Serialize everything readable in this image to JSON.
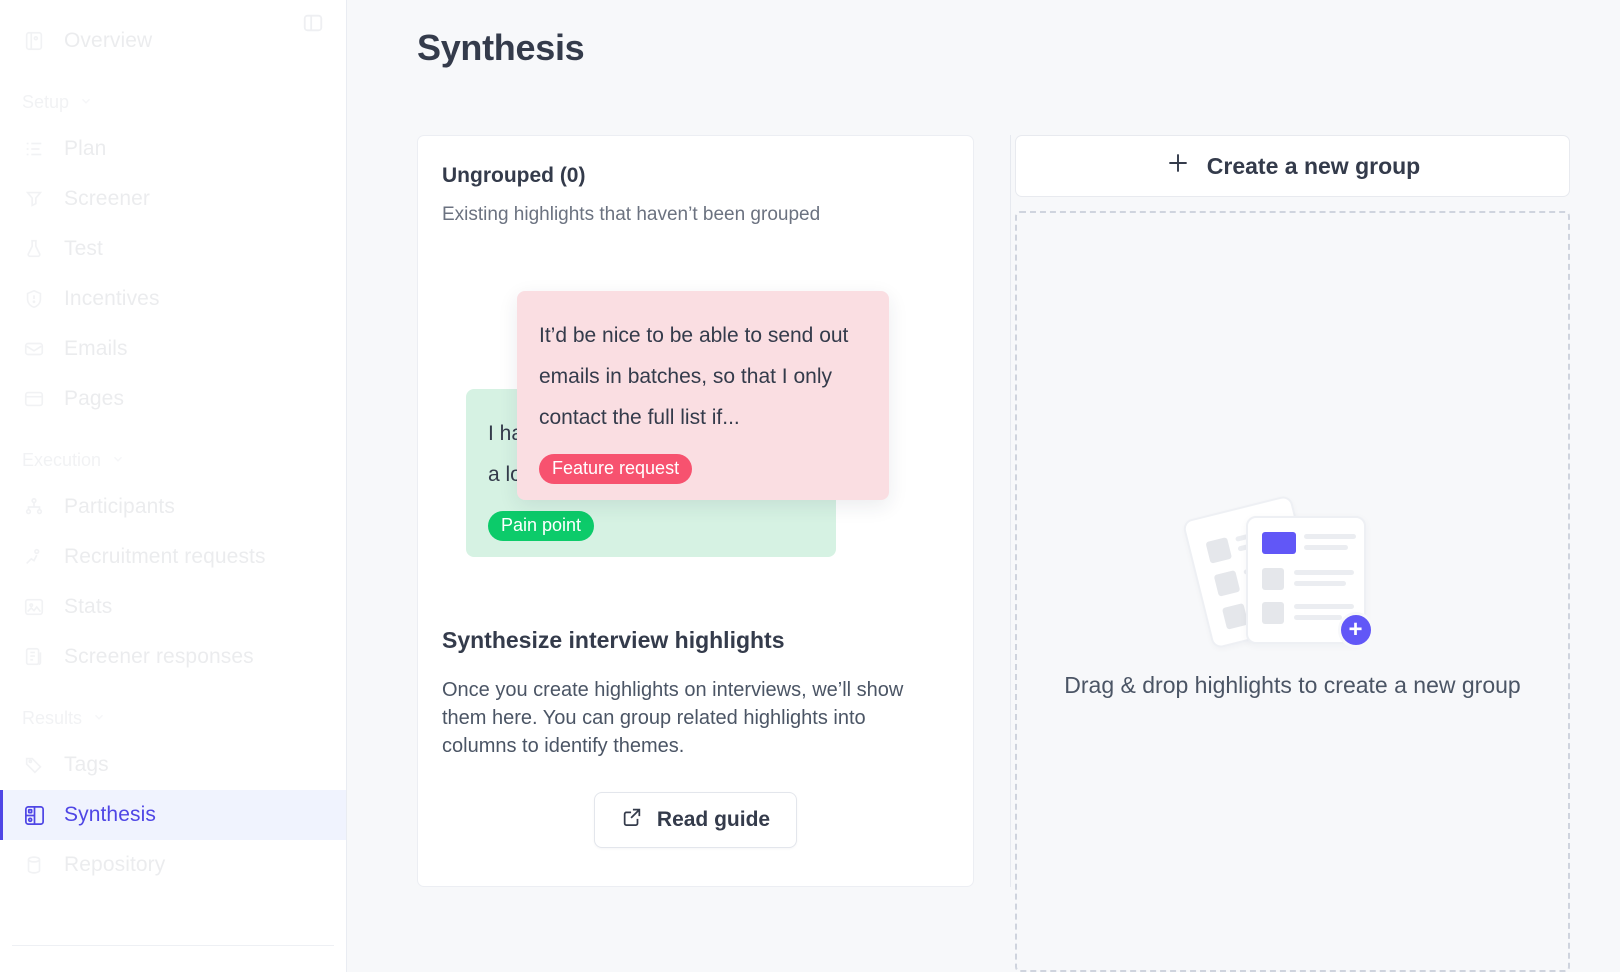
{
  "sidebar": {
    "panel_toggle_icon": "panel-collapse-icon",
    "top_items": [
      {
        "label": "Overview",
        "icon": "overview-icon",
        "key": "overview"
      }
    ],
    "sections": [
      {
        "label": "Setup",
        "chevron_icon": "chevron-down-icon",
        "items": [
          {
            "label": "Plan",
            "icon": "list-icon",
            "key": "plan"
          },
          {
            "label": "Screener",
            "icon": "filter-icon",
            "key": "screener"
          },
          {
            "label": "Test",
            "icon": "flask-icon",
            "key": "test"
          },
          {
            "label": "Incentives",
            "icon": "shield-icon",
            "key": "incentives"
          },
          {
            "label": "Emails",
            "icon": "mail-icon",
            "key": "emails"
          },
          {
            "label": "Pages",
            "icon": "window-icon",
            "key": "pages"
          }
        ]
      },
      {
        "label": "Execution",
        "chevron_icon": "chevron-down-icon",
        "items": [
          {
            "label": "Participants",
            "icon": "people-icon",
            "key": "participants"
          },
          {
            "label": "Recruitment requests",
            "icon": "user-plus-icon",
            "key": "recruitment-requests"
          },
          {
            "label": "Stats",
            "icon": "image-chart-icon",
            "key": "stats"
          },
          {
            "label": "Screener responses",
            "icon": "documents-icon",
            "key": "screener-responses"
          }
        ]
      },
      {
        "label": "Results",
        "chevron_icon": "chevron-down-icon",
        "items": [
          {
            "label": "Tags",
            "icon": "tag-icon",
            "key": "tags"
          },
          {
            "label": "Synthesis",
            "icon": "grid-board-icon",
            "key": "synthesis",
            "active": true
          },
          {
            "label": "Repository",
            "icon": "database-icon",
            "key": "repository"
          }
        ]
      }
    ]
  },
  "header": {
    "title": "Synthesis"
  },
  "ungrouped": {
    "title": "Ungrouped (0)",
    "subtitle": "Existing highlights that haven’t been grouped",
    "highlights": [
      {
        "text": "I ha… the… know the answers to a lot of the required questions,…",
        "badge": "Pain point",
        "badge_color": "#0ccb6a",
        "card_color": "#d6f2e3"
      },
      {
        "text": "It’d be nice to be able to send out emails in batches, so that I only contact the full list if...",
        "badge": "Feature request",
        "badge_color": "#f7526f",
        "card_color": "#fadee2"
      }
    ],
    "empty_state": {
      "title": "Synthesize interview highlights",
      "body": "Once you create highlights on interviews, we’ll show them here. You can group related highlights into columns to identify themes.",
      "button_label": "Read guide",
      "button_icon": "external-link-icon"
    }
  },
  "groups": {
    "create_button_label": "Create a new group",
    "create_button_icon": "plus-icon",
    "dropzone_text": "Drag & drop highlights to create a new group",
    "dropzone_illustration": "documents-add-illustration",
    "accent_color": "#6157f7"
  }
}
